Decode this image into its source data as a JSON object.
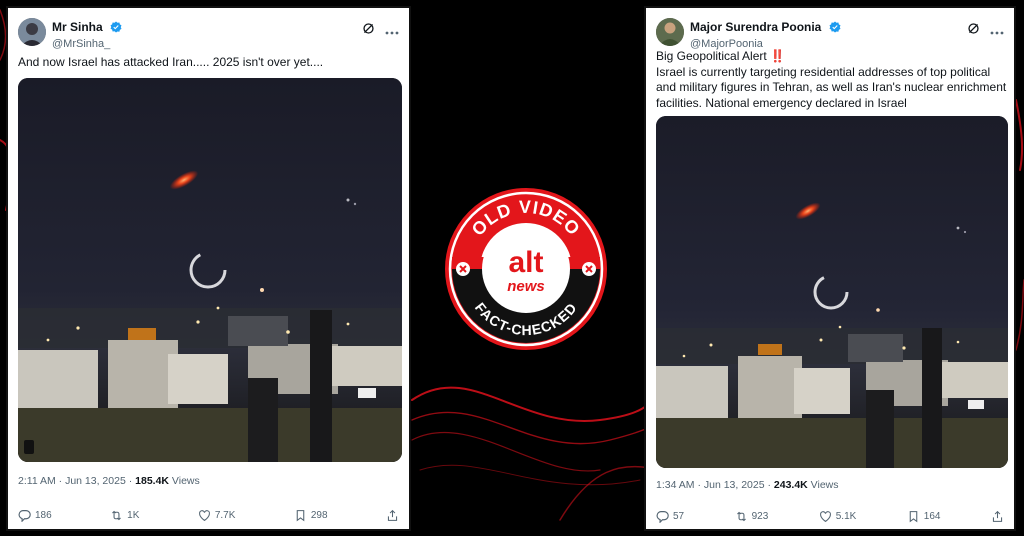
{
  "left_post": {
    "author_name": "Mr Sinha",
    "handle": "@MrSinha_",
    "text": "And now Israel has attacked Iran..... 2025 isn't over yet....",
    "timestamp": "2:11 AM · Jun 13, 2025 · ",
    "views_count": "185.4K",
    "views_label": " Views",
    "replies": "186",
    "reposts": "1K",
    "likes": "7.7K",
    "bookmarks": "298"
  },
  "right_post": {
    "author_name": "Major Surendra Poonia",
    "handle": "@MajorPoonia",
    "text_line1": "Big Geopolitical Alert",
    "alert_marks": "‼️",
    "text_body": "Israel is currently targeting residential addresses of top political and military figures in Tehran, as well as Iran's nuclear enrichment facilities. National emergency declared in Israel",
    "timestamp": "1:34 AM · Jun 13, 2025 · ",
    "views_count": "243.4K",
    "views_label": " Views",
    "replies": "57",
    "reposts": "923",
    "likes": "5.1K",
    "bookmarks": "164"
  },
  "badge": {
    "top_text": "OLD VIDEO",
    "logo_alt": "alt",
    "logo_news": "news",
    "bottom_text": "FACT-CHECKED"
  },
  "colors": {
    "badge_red": "#e3161b",
    "verified_blue": "#1d9bf0",
    "background": "#000000",
    "swirl": "#d0101a"
  }
}
